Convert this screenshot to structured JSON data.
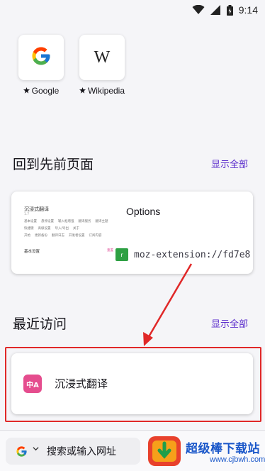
{
  "status_bar": {
    "time": "9:14"
  },
  "shortcuts": [
    {
      "label": "Google",
      "icon": "google-logo-icon"
    },
    {
      "label": "Wikipedia",
      "icon": "wikipedia-logo-icon",
      "glyph": "W"
    }
  ],
  "jump_back_in": {
    "title": "回到先前页面",
    "show_all": "显示全部",
    "card": {
      "title": "Options",
      "url": "moz-extension://fd7e8",
      "favicon_glyph": "r",
      "thumbnail": {
        "title": "沉浸式翻译",
        "sub": "1.7",
        "rows": [
          [
            "基本设置",
            "悬停设置",
            "输入框增强",
            "翻译服务",
            "翻译主题"
          ],
          [
            "快捷键",
            "高级设置",
            "导入/导出",
            "关于"
          ],
          [
            "开始",
            "更新备份",
            "翻译日志",
            "开发者设置",
            "订阅内容"
          ]
        ],
        "bottom_label": "基本设置",
        "bottom_pink": "重置"
      }
    }
  },
  "recently_visited": {
    "title": "最近访问",
    "show_all": "显示全部",
    "items": [
      {
        "label": "沉浸式翻译",
        "icon": "immersive-translate-icon",
        "icon_text": "中A"
      }
    ]
  },
  "toolbar": {
    "search_placeholder": "搜索或输入网址",
    "engine_icon": "google-logo-icon"
  },
  "watermark": {
    "text": "超级棒下载站",
    "sub": "www.cjbwh.com"
  },
  "colors": {
    "accent": "#592acb",
    "highlight": "#e02828",
    "app_icon": "#e54d8e"
  }
}
